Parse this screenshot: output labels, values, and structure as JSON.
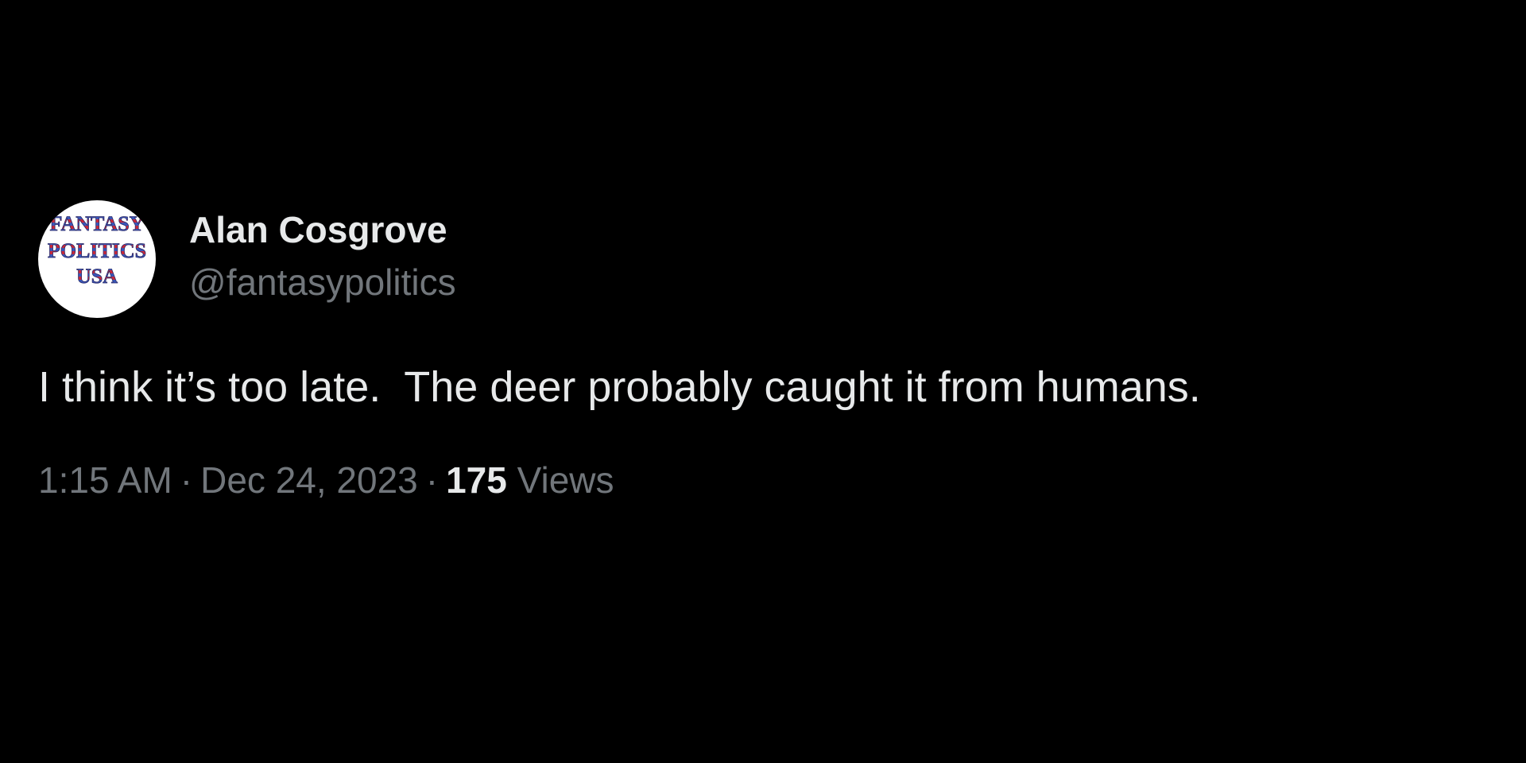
{
  "avatar": {
    "logo_line1": "FANTASY",
    "logo_line2": "POLITICS",
    "logo_line3": "USA"
  },
  "author": {
    "display_name": "Alan Cosgrove",
    "handle": "@fantasypolitics"
  },
  "tweet": {
    "text": "I think it’s too late.  The deer probably caught it from humans.",
    "time": "1:15 AM",
    "separator": "·",
    "date": "Dec 24, 2023",
    "views_count": "175",
    "views_label": "Views"
  },
  "colors": {
    "background": "#000000",
    "primary_text": "#e7e9ea",
    "secondary_text": "#71767b"
  }
}
